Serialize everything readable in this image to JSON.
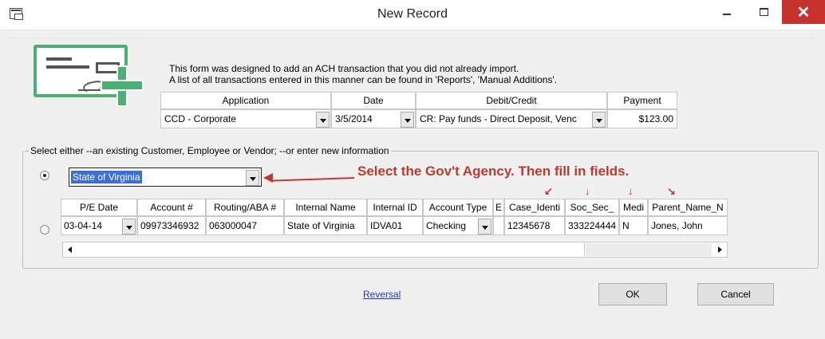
{
  "window": {
    "title": "New Record",
    "minimize_glyph": "—",
    "maximize_glyph": "☐",
    "close_glyph": "✕"
  },
  "intro": {
    "line1": "This form was designed to add an ACH transaction that you did not already import.",
    "line2": "A list of all transactions entered in this manner can be found in 'Reports', 'Manual Additions'."
  },
  "transaction": {
    "headers": [
      "Application",
      "Date",
      "Debit/Credit",
      "Payment"
    ],
    "application": "CCD - Corporate",
    "date": "3/5/2014",
    "debit_credit": "CR: Pay funds - Direct Deposit, Venc",
    "payment": "$123.00"
  },
  "selection": {
    "group_label": "Select either --an existing Customer, Employee or Vendor;  --or enter new information",
    "existing_selected": true,
    "existing_value": "State of Virginia"
  },
  "annotation": {
    "text": "Select the Gov't Agency. Then fill in fields.",
    "color": "#c0392b"
  },
  "new_info": {
    "headers": [
      "P/E Date",
      "Account #",
      "Routing/ABA #",
      "Internal Name",
      "Internal ID",
      "Account Type",
      "E",
      "Case_Identi",
      "Soc_Sec_",
      "Medi",
      "Parent_Name_N"
    ],
    "row": [
      "03-04-14",
      "09973346932",
      "063000047",
      "State of Virginia",
      "IDVA01",
      "Checking",
      "",
      "12345678",
      "333224444",
      "N",
      "Jones, John"
    ]
  },
  "footer": {
    "reversal_link": "Reversal",
    "ok_label": "OK",
    "cancel_label": "Cancel"
  },
  "colors": {
    "brand_green": "#4caf73",
    "close_red": "#c7312b",
    "selection_blue": "#3b6fd8",
    "link_blue": "#1a3fbf"
  }
}
